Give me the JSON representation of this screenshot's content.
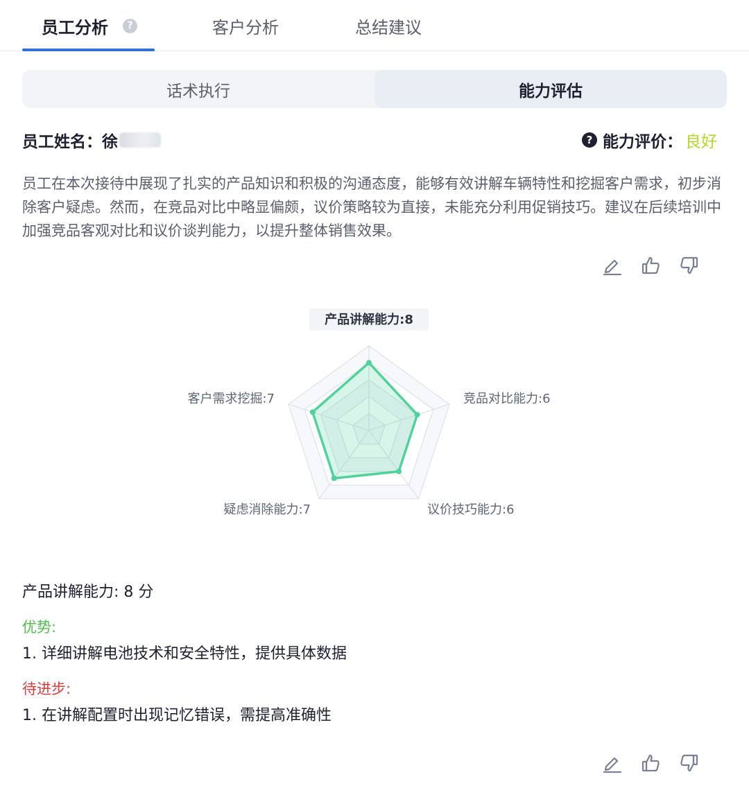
{
  "tabs": {
    "items": [
      {
        "label": "员工分析",
        "active": true
      },
      {
        "label": "客户分析",
        "active": false
      },
      {
        "label": "总结建议",
        "active": false
      }
    ],
    "help_glyph": "?"
  },
  "segment": {
    "left_label": "话术执行",
    "right_label": "能力评估",
    "selected": "能力评估"
  },
  "employee": {
    "name_label": "员工姓名：",
    "name_visible": "徐",
    "rating_label": "能力评价：",
    "rating_value": "良好",
    "rating_color": "#b5d92a"
  },
  "summary": "员工在本次接待中展现了扎实的产品知识和积极的沟通态度，能够有效讲解车辆特性和挖掘客户需求，初步消除客户疑虑。然而，在竞品对比中略显偏颇，议价策略较为直接，未能充分利用促销技巧。建议在后续培训中加强竞品客观对比和议价谈判能力，以提升整体销售效果。",
  "actions": [
    "edit-icon",
    "thumbs-up-icon",
    "thumbs-down-icon"
  ],
  "chart_data": {
    "type": "radar",
    "max": 10,
    "axes": [
      {
        "label": "产品讲解能力:8",
        "value": 8
      },
      {
        "label": "竞品对比能力:6",
        "value": 6
      },
      {
        "label": "议价技巧能力:6",
        "value": 6
      },
      {
        "label": "疑虑消除能力:7",
        "value": 7
      },
      {
        "label": "客户需求挖掘:7",
        "value": 7
      }
    ],
    "series_color": "#4fd39a"
  },
  "detail": {
    "title": "产品讲解能力: 8 分",
    "advantage_label": "优势:",
    "advantage_item": "1. 详细讲解电池技术和安全特性，提供具体数据",
    "improve_label": "待进步:",
    "improve_item": "1. 在讲解配置时出现记忆错误，需提高准确性",
    "advantage_color": "#4cc24c",
    "improve_color": "#e03b3b"
  }
}
